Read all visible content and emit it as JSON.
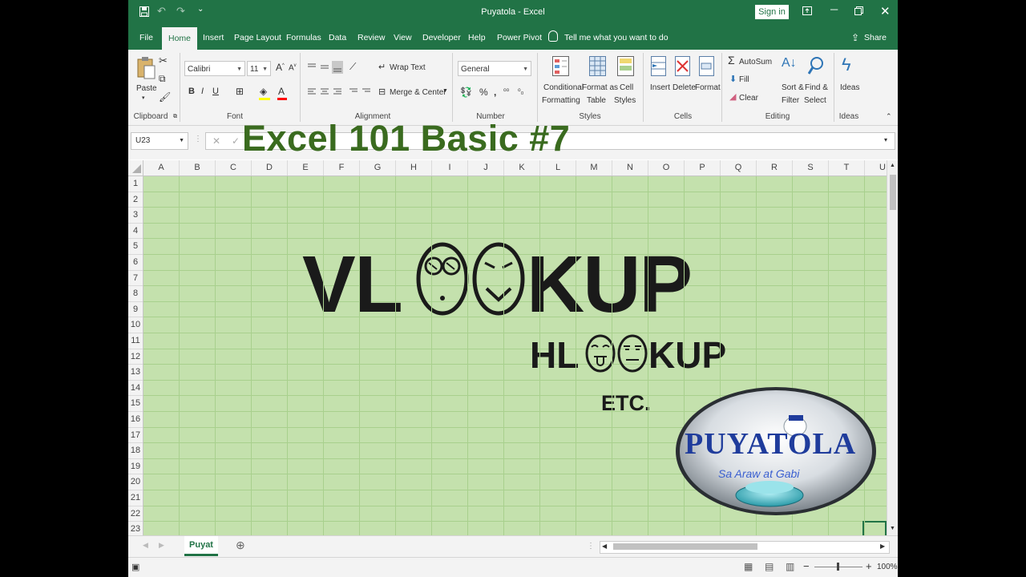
{
  "window": {
    "title": "Puyatola  -  Excel",
    "sign_in": "Sign in"
  },
  "tabs": [
    "File",
    "Home",
    "Insert",
    "Page Layout",
    "Formulas",
    "Data",
    "Review",
    "View",
    "Developer",
    "Help",
    "Power Pivot"
  ],
  "active_tab": "Home",
  "tell_me": "Tell me what you want to do",
  "share": "Share",
  "ribbon": {
    "clipboard": {
      "paste": "Paste",
      "group": "Clipboard"
    },
    "font": {
      "name": "Calibri",
      "size": "11",
      "bold": "B",
      "italic": "I",
      "underline": "U",
      "group": "Font"
    },
    "alignment": {
      "wrap_text": "Wrap Text",
      "merge_center": "Merge & Center",
      "group": "Alignment"
    },
    "number": {
      "format": "General",
      "group": "Number"
    },
    "styles": {
      "conditional": "Conditional",
      "conditional2": "Formatting",
      "format_as": "Format as",
      "format_as2": "Table",
      "cell": "Cell",
      "cell2": "Styles",
      "group": "Styles"
    },
    "cells": {
      "insert": "Insert",
      "delete": "Delete",
      "format": "Format",
      "group": "Cells"
    },
    "editing": {
      "autosum": "AutoSum",
      "fill": "Fill",
      "clear": "Clear",
      "sort": "Sort &",
      "sort2": "Filter",
      "find": "Find &",
      "find2": "Select",
      "group": "Editing"
    },
    "ideas": {
      "label": "Ideas",
      "group": "Ideas"
    }
  },
  "name_box": "U23",
  "headline": "Excel 101 Basic #7",
  "columns": [
    "A",
    "B",
    "C",
    "D",
    "E",
    "F",
    "G",
    "H",
    "I",
    "J",
    "K",
    "L",
    "M",
    "N",
    "O",
    "P",
    "Q",
    "R",
    "S",
    "T",
    "U"
  ],
  "rows": [
    "1",
    "2",
    "3",
    "4",
    "5",
    "6",
    "7",
    "8",
    "9",
    "10",
    "11",
    "12",
    "13",
    "14",
    "15",
    "16",
    "17",
    "18",
    "19",
    "20",
    "21",
    "22",
    "23"
  ],
  "art": {
    "vlookup_left": "VL",
    "vlookup_right": "KUP",
    "hlookup_left": "HL",
    "hlookup_right": "KUP",
    "etc": "ETC."
  },
  "logo": {
    "name": "PUYATOLA",
    "tagline": "Sa Araw at Gabi"
  },
  "sheet_tab": "Puyat",
  "zoom": "100%"
}
